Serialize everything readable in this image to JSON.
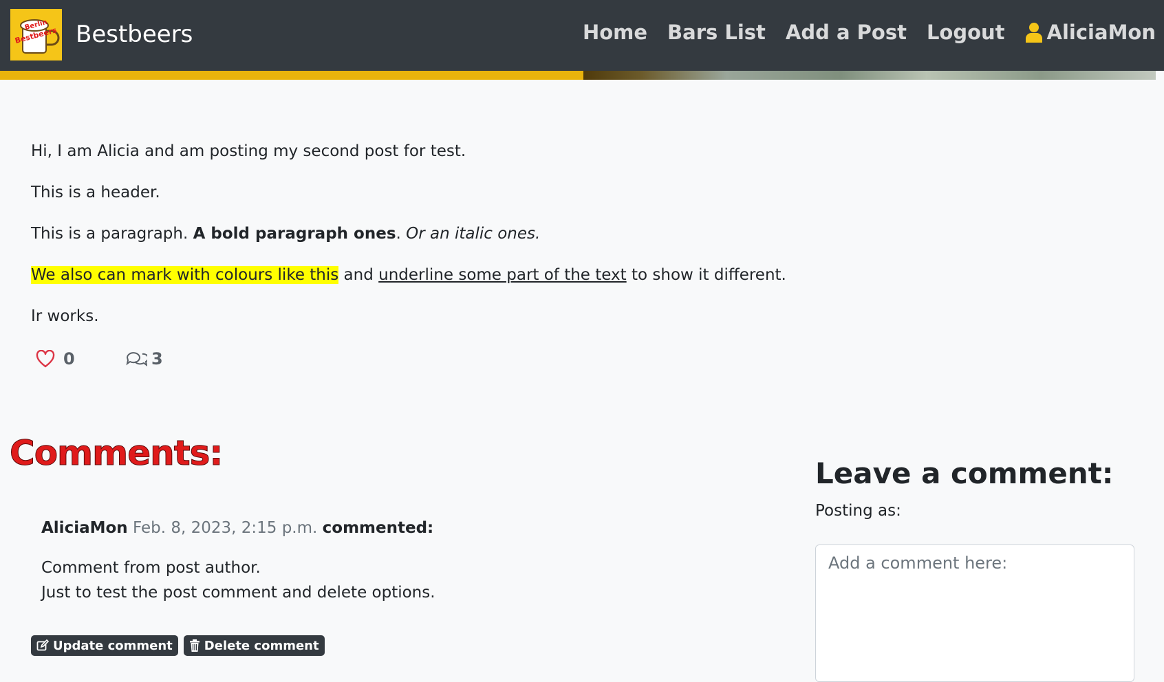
{
  "navbar": {
    "brand": "Bestbeers",
    "logo_text": "Berlin Bestbeers",
    "links": [
      "Home",
      "Bars List",
      "Add a Post",
      "Logout"
    ],
    "user": "AliciaMon",
    "colors": {
      "bg": "#343a40",
      "accent": "#f5c518"
    }
  },
  "post": {
    "line1": "Hi, I am Alicia and am posting my second post for test.",
    "line2": "This is a header.",
    "line3_plain": "This is a paragraph. ",
    "line3_bold": "A bold paragraph ones",
    "line3_dot": ". ",
    "line3_italic": "Or an italic ones.",
    "line4_highlight": "We also can mark with colours  like this",
    "line4_and": " and ",
    "line4_underline": "underline some part of the text",
    "line4_end": " to show it different.",
    "line5": "Ir works.",
    "likes": "0",
    "comments_count": "3"
  },
  "comments": {
    "title": "Comments:",
    "item": {
      "author": "AliciaMon",
      "date": "Feb. 8, 2023, 2:15 p.m.",
      "verb": "commented:",
      "text1": "Comment from post author.",
      "text2": "Just to test the post comment and delete options."
    },
    "update_label": "Update comment",
    "delete_label": "Delete comment"
  },
  "leave": {
    "title": "Leave a comment:",
    "posting_as": "Posting as:",
    "placeholder": "Add a comment here:"
  }
}
